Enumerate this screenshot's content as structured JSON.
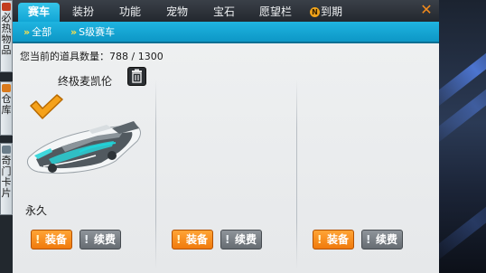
{
  "sidebar": {
    "items": [
      {
        "label": "必热物品"
      },
      {
        "label": "仓库"
      },
      {
        "label": "奇门卡片"
      }
    ]
  },
  "tabs": [
    {
      "label": "赛车",
      "active": true
    },
    {
      "label": "装扮",
      "active": false
    },
    {
      "label": "功能",
      "active": false
    },
    {
      "label": "宠物",
      "active": false
    },
    {
      "label": "宝石",
      "active": false
    },
    {
      "label": "愿望栏",
      "active": false
    },
    {
      "label": "到期",
      "badge": "N",
      "active": false
    }
  ],
  "breadcrumb": [
    {
      "label": "全部"
    },
    {
      "label": "S级赛车"
    }
  ],
  "item_count": {
    "label": "您当前的道具数量：",
    "current": "788",
    "separator": "/",
    "capacity": "1300"
  },
  "slots": [
    {
      "name": "终极麦凯伦",
      "duration": "永久",
      "equipped": true,
      "equip_label": "装备",
      "renew_label": "续费"
    },
    {
      "name": "",
      "duration": "",
      "equipped": false,
      "equip_label": "装备",
      "renew_label": "续费"
    },
    {
      "name": "",
      "duration": "",
      "equipped": false,
      "equip_label": "装备",
      "renew_label": "续费"
    }
  ],
  "icons": {
    "close": "close-icon",
    "trash": "trash-icon",
    "check": "check-icon",
    "chevron": "double-chevron-right-icon",
    "alert": "exclamation-icon"
  },
  "colors": {
    "tab_active": "#1aa9d8",
    "subbar": "#14a6d4",
    "equip_button": "#f07a0c",
    "renew_button": "#6e747a",
    "check_mark": "#f5a21b",
    "close": "#f28a1c"
  }
}
